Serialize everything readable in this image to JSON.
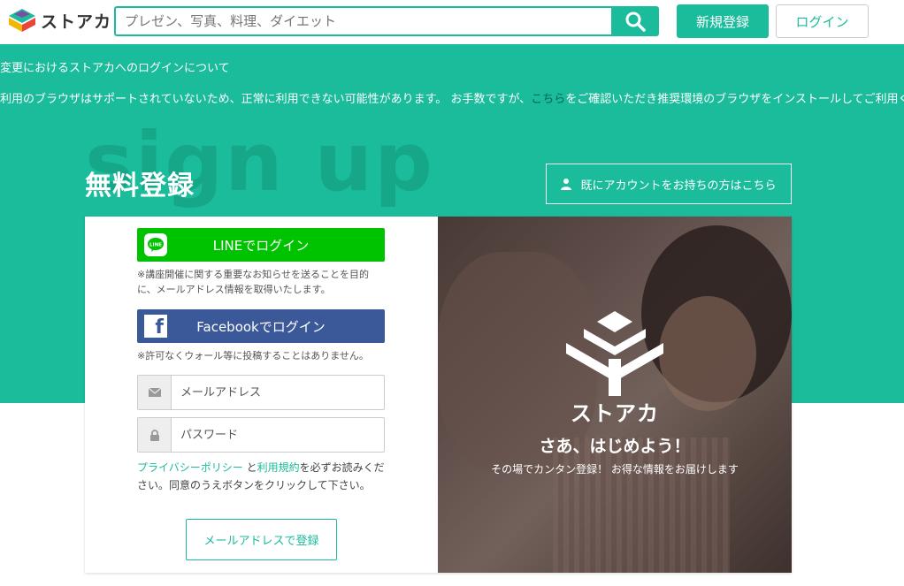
{
  "header": {
    "logo_text": "ストアカ",
    "search_placeholder": "プレゼン、写真、料理、ダイエット",
    "register_label": "新規登録",
    "login_label": "ログイン"
  },
  "notices": {
    "line1": "変更におけるストアカへのログインについて",
    "line2_before": "利用のブラウザはサポートされていないため、正常に利用できない可能性があります。 お手数ですが、",
    "line2_link": "こちら",
    "line2_after": "をご確認いただき推奨環境のブラウザをインストールしてご利用く"
  },
  "signup": {
    "bg_word": "sign up",
    "title": "無料登録",
    "existing_account_label": "既にアカウントをお持ちの方はこちら"
  },
  "form": {
    "line_button": "LINEでログイン",
    "line_note": "※講座開催に関する重要なお知らせを送ることを目的に、メールアドレス情報を取得いたします。",
    "facebook_button": "Facebookでログイン",
    "facebook_note": "※許可なくウォール等に投稿することはありません。",
    "email_placeholder": "メールアドレス",
    "password_placeholder": "パスワード",
    "privacy_link": "プライバシーポリシー",
    "and_text": " と",
    "terms_link": "利用規約",
    "agree_text": "を必ずお読みください。同意のうえボタンをクリックして下さい。",
    "submit_button": "メールアドレスで登録"
  },
  "hero": {
    "brand": "ストアカ",
    "title": "さあ、はじめよう！",
    "subtitle": "その場でカンタン登録！ お得な情報をお届けします"
  },
  "colors": {
    "brand_green": "#1bbc9b",
    "line_green": "#00c300",
    "facebook_blue": "#3b5998"
  }
}
